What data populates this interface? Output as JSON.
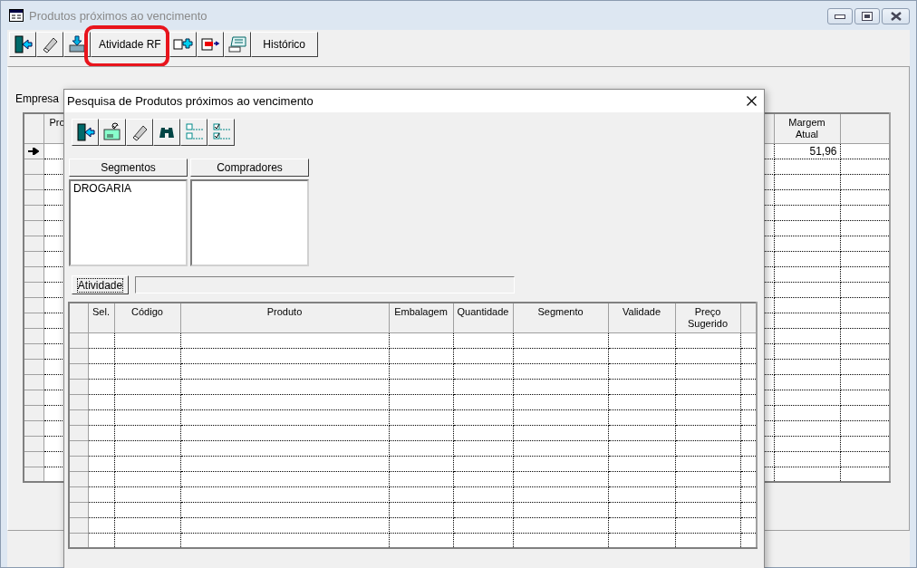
{
  "main_window": {
    "title": "Produtos próximos ao vencimento",
    "toolbar": [
      {
        "kind": "icon"
      },
      {
        "kind": "icon"
      },
      {
        "kind": "icon"
      },
      {
        "kind": "text",
        "label": "Atividade RF",
        "highlighted": true
      },
      {
        "kind": "icon"
      },
      {
        "kind": "icon"
      },
      {
        "kind": "icon"
      },
      {
        "kind": "text",
        "label": "Histórico",
        "highlighted": false
      }
    ],
    "empresa_label": "Empresa",
    "grid": {
      "columns": [
        "Pro",
        "Margem Atual"
      ],
      "rows": [
        {
          "current": true,
          "margem_atual": "51,96"
        }
      ]
    }
  },
  "dialog": {
    "title": "Pesquisa de Produtos próximos ao vencimento",
    "lists": [
      {
        "header": "Segmentos",
        "items": [
          "DROGARIA"
        ]
      },
      {
        "header": "Compradores"
      }
    ],
    "atividade_button": "Atividade",
    "grid": {
      "columns": [
        "Sel.",
        "Código",
        "Produto",
        "Embalagem",
        "Quantidade",
        "Segmento",
        "Validade",
        "Preço Sugerido"
      ]
    }
  }
}
